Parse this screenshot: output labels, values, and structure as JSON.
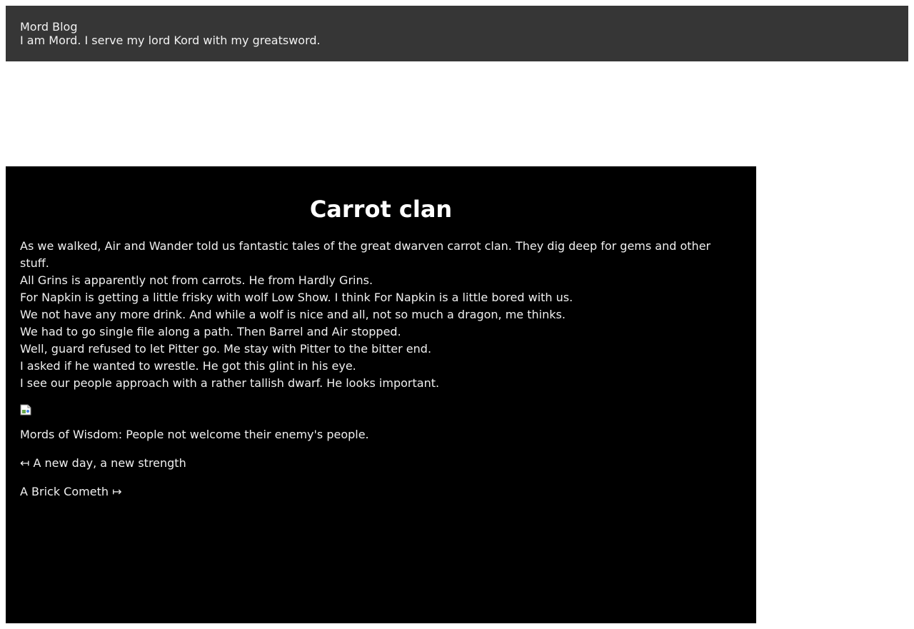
{
  "header": {
    "title": "Mord Blog",
    "tagline": "I am Mord. I serve my lord Kord with my greatsword."
  },
  "post": {
    "title": "Carrot clan",
    "lines": [
      "As we walked, Air and Wander told us fantastic tales of the great dwarven carrot clan. They dig deep for gems and other stuff.",
      "All Grins is apparently not from carrots. He from Hardly Grins.",
      "For Napkin is getting a little frisky with wolf Low Show. I think For Napkin is a little bored with us.",
      "We not have any more drink. And while a wolf is nice and all, not so much a dragon, me thinks.",
      "We had to go single file along a path. Then Barrel and Air stopped.",
      "Well, guard refused to let Pitter go. Me stay with Pitter to the bitter end.",
      "I asked if he wanted to wrestle. He got this glint in his eye.",
      "I see our people approach with a rather tallish dwarf. He looks important."
    ],
    "wisdom": "Mords of Wisdom: People not welcome their enemy's people.",
    "prev_link": "↤ A new day, a new strength",
    "next_link": "A Brick Cometh ↦"
  }
}
